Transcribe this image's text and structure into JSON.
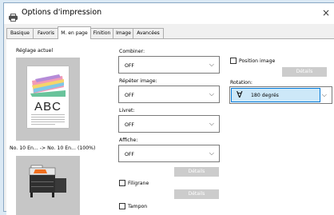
{
  "window": {
    "title": "Options d'impression",
    "close_icon": "×"
  },
  "tabs": [
    {
      "label": "Basique",
      "active": false
    },
    {
      "label": "Favoris",
      "active": false
    },
    {
      "label": "M. en page",
      "active": true
    },
    {
      "label": "Finition",
      "active": false
    },
    {
      "label": "Image",
      "active": false
    },
    {
      "label": "Avancées",
      "active": false
    }
  ],
  "left": {
    "current_setting_label": "Réglage actuel",
    "doc_text": "ABC",
    "paper_info": "No. 10 En... -> No. 10 En... (100%)"
  },
  "combiner": {
    "label": "Combiner:",
    "value": "OFF"
  },
  "repeat": {
    "label": "Répéter image:",
    "value": "OFF"
  },
  "booklet": {
    "label": "Livret:",
    "value": "OFF"
  },
  "poster": {
    "label": "Affiche:",
    "value": "OFF"
  },
  "details_label": "Détails",
  "watermark": {
    "label": "Filigrane",
    "checked": false
  },
  "stamp": {
    "label": "Tampon",
    "checked": false
  },
  "image_position": {
    "label": "Position image",
    "checked": false
  },
  "rotation": {
    "label": "Rotation:",
    "value": "180 degrés",
    "icon": "∀"
  },
  "colors": {
    "accent": "#cde8f8",
    "accent_border": "#0078d7",
    "disabled_button": "#cccccc"
  }
}
